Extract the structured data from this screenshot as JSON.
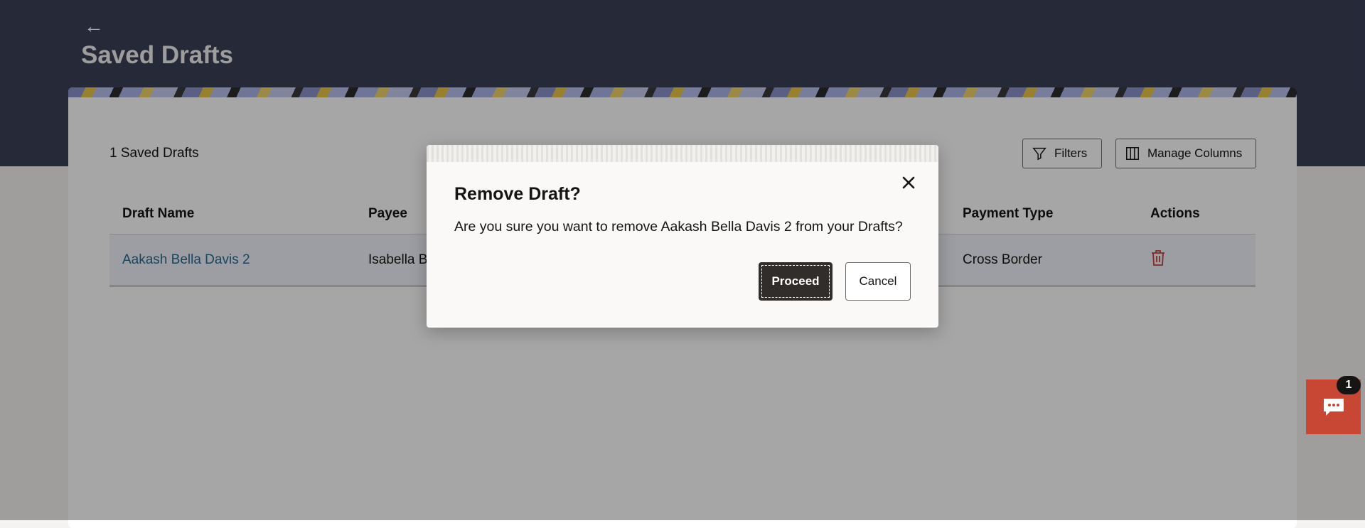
{
  "header": {
    "back_icon": "arrow-left-icon",
    "title": "Saved Drafts"
  },
  "drafts": {
    "count_label": "1 Saved Drafts",
    "filters_label": "Filters",
    "manage_columns_label": "Manage Columns",
    "columns": {
      "draft_name": "Draft Name",
      "payee": "Payee",
      "payment_type": "Payment Type",
      "actions": "Actions"
    },
    "rows": [
      {
        "draft_name": "Aakash Bella Davis 2",
        "payee": "Isabella B",
        "payment_type": "Cross Border",
        "action_icon": "trash-icon"
      }
    ]
  },
  "dialog": {
    "title": "Remove Draft?",
    "message": "Are you sure you want to remove Aakash Bella Davis 2 from your Drafts?",
    "proceed_label": "Proceed",
    "cancel_label": "Cancel",
    "close_icon": "close-icon"
  },
  "chat": {
    "icon": "chat-icon",
    "badge_count": "1"
  },
  "colors": {
    "header_bg": "#3a3f57",
    "link": "#2a6a8f",
    "primary_button": "#312d2a",
    "delete_icon": "#c0463a",
    "chat_button": "#c74634"
  }
}
